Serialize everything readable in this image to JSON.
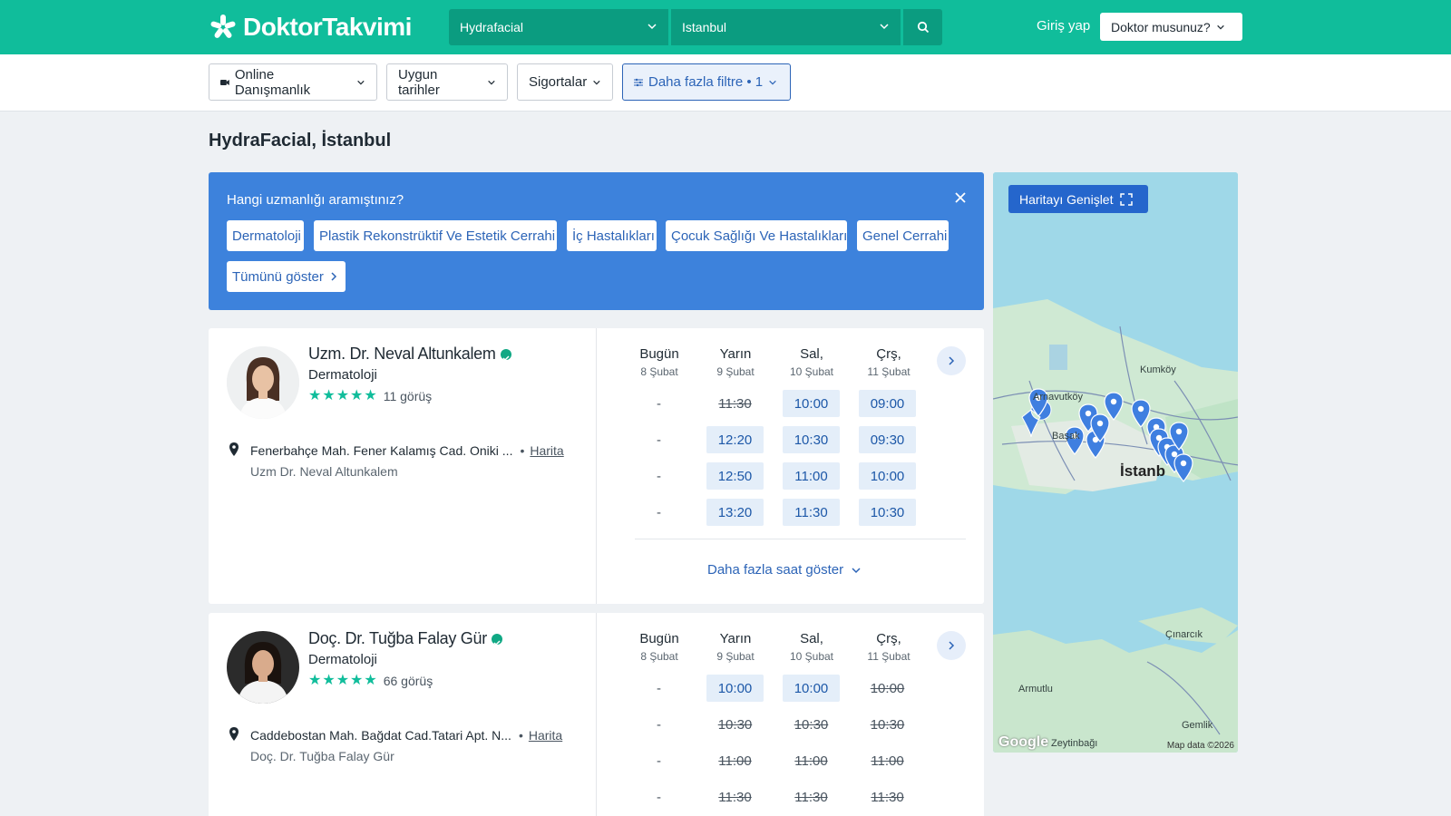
{
  "header": {
    "logo_text": "DoktorTakvimi",
    "specialty_select": "Hydrafacial",
    "city_select": "Istanbul",
    "login_label": "Giriş yap",
    "doctor_menu_label": "Doktor musunuz?"
  },
  "filters": {
    "online": "Online Danışmanlık",
    "dates": "Uygun tarihler",
    "insurance": "Sigortalar",
    "more": "Daha fazla filtre • 1"
  },
  "page_title": "HydraFacial, İstanbul",
  "specialty_prompt": {
    "question": "Hangi uzmanlığı aramıştınız?",
    "chips": [
      "Dermatoloji",
      "Plastik Rekonstrüktif Ve Estetik Cerrahi",
      "İç Hastalıkları",
      "Çocuk Sağlığı Ve Hastalıkları",
      "Genel Cerrahi"
    ],
    "show_all": "Tümünü göster"
  },
  "days": [
    {
      "name": "Bugün",
      "date": "8 Şubat"
    },
    {
      "name": "Yarın",
      "date": "9 Şubat"
    },
    {
      "name": "Sal,",
      "date": "10 Şubat"
    },
    {
      "name": "Çrş,",
      "date": "11 Şubat"
    }
  ],
  "doctors": [
    {
      "name": "Uzm. Dr. Neval Altunkalem",
      "specialty": "Dermatoloji",
      "reviews": "11 görüş",
      "address": "Fenerbahçe Mah. Fener Kalamış Cad. Oniki ...",
      "map_link": "Harita",
      "clinic": "Uzm Dr. Neval Altunkalem",
      "more_hours": "Daha fazla saat göster"
    },
    {
      "name": "Doç. Dr. Tuğba Falay Gür",
      "specialty": "Dermatoloji",
      "reviews": "66 görüş",
      "address": "Caddebostan Mah. Bağdat Cad.Tatari Apt. N...",
      "map_link": "Harita",
      "clinic": "Doç. Dr. Tuğba Falay Gür"
    }
  ],
  "slots_doc1": [
    [
      {
        "t": "-",
        "s": "none"
      },
      {
        "t": "11:30",
        "s": "taken"
      },
      {
        "t": "10:00",
        "s": "avail"
      },
      {
        "t": "09:00",
        "s": "avail"
      }
    ],
    [
      {
        "t": "-",
        "s": "none"
      },
      {
        "t": "12:20",
        "s": "avail"
      },
      {
        "t": "10:30",
        "s": "avail"
      },
      {
        "t": "09:30",
        "s": "avail"
      }
    ],
    [
      {
        "t": "-",
        "s": "none"
      },
      {
        "t": "12:50",
        "s": "avail"
      },
      {
        "t": "11:00",
        "s": "avail"
      },
      {
        "t": "10:00",
        "s": "avail"
      }
    ],
    [
      {
        "t": "-",
        "s": "none"
      },
      {
        "t": "13:20",
        "s": "avail"
      },
      {
        "t": "11:30",
        "s": "avail"
      },
      {
        "t": "10:30",
        "s": "avail"
      }
    ]
  ],
  "slots_doc2": [
    [
      {
        "t": "-",
        "s": "none"
      },
      {
        "t": "10:00",
        "s": "avail"
      },
      {
        "t": "10:00",
        "s": "avail"
      },
      {
        "t": "10:00",
        "s": "taken"
      }
    ],
    [
      {
        "t": "-",
        "s": "none"
      },
      {
        "t": "10:30",
        "s": "taken"
      },
      {
        "t": "10:30",
        "s": "taken"
      },
      {
        "t": "10:30",
        "s": "taken"
      }
    ],
    [
      {
        "t": "-",
        "s": "none"
      },
      {
        "t": "11:00",
        "s": "taken"
      },
      {
        "t": "11:00",
        "s": "taken"
      },
      {
        "t": "11:00",
        "s": "taken"
      }
    ],
    [
      {
        "t": "-",
        "s": "none"
      },
      {
        "t": "11:30",
        "s": "taken"
      },
      {
        "t": "11:30",
        "s": "taken"
      },
      {
        "t": "11:30",
        "s": "taken"
      }
    ]
  ],
  "map": {
    "expand_label": "Haritayı Genişlet",
    "labels": [
      "Kumköy",
      "Arnavutköy",
      "Başak",
      "İstanb",
      "Çınarcık",
      "Armutlu",
      "Gemlik",
      "Zeytinbağı"
    ],
    "credit": "Map data ©2026",
    "google": "Google"
  },
  "colors": {
    "brand": "#10bd9b",
    "link": "#2c64b7",
    "blue_box": "#3d82dc",
    "slot_bg": "#e4eef9"
  }
}
